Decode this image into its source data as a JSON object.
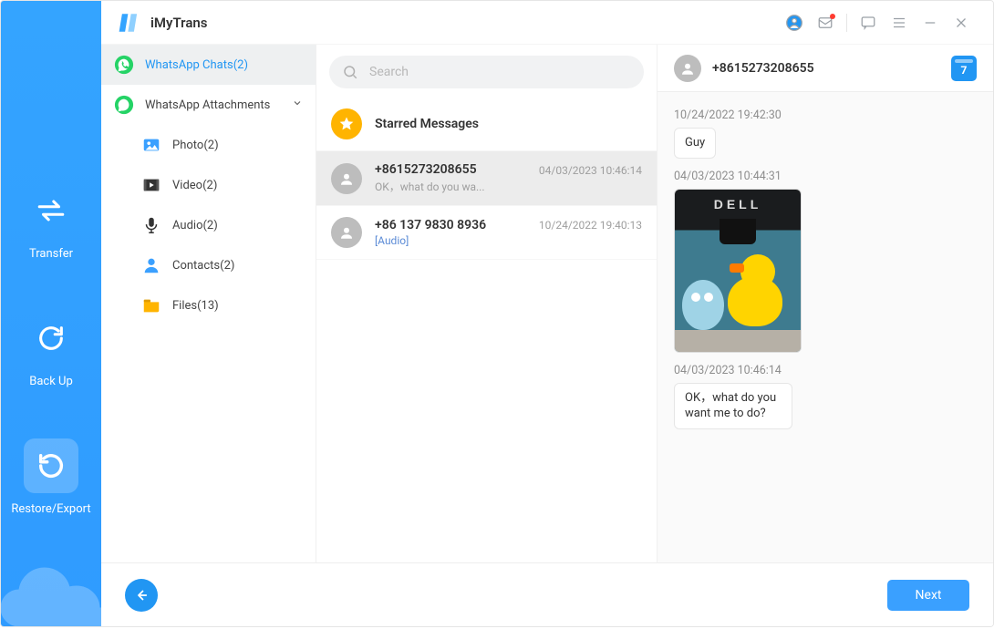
{
  "app": {
    "name": "iMyTrans"
  },
  "titlebar": {
    "calendar_day": "7"
  },
  "rail": {
    "items": [
      {
        "label": "Transfer"
      },
      {
        "label": "Back Up"
      },
      {
        "label": "Restore/Export"
      }
    ]
  },
  "tree": {
    "chats": {
      "label": "WhatsApp Chats(2)"
    },
    "attachments": {
      "label": "WhatsApp Attachments"
    },
    "photo": {
      "label": "Photo(2)"
    },
    "video": {
      "label": "Video(2)"
    },
    "audio": {
      "label": "Audio(2)"
    },
    "contacts": {
      "label": "Contacts(2)"
    },
    "files": {
      "label": "Files(13)"
    }
  },
  "search": {
    "placeholder": "Search"
  },
  "chats": {
    "starred": {
      "title": "Starred Messages"
    },
    "items": [
      {
        "title": "+8615273208655",
        "sub": "OK，what do you wa...",
        "time": "04/03/2023 10:46:14"
      },
      {
        "title": "+86 137 9830 8936",
        "sub": "[Audio]",
        "time": "10/24/2022 19:40:13"
      }
    ]
  },
  "conversation": {
    "contact": "+8615273208655",
    "messages": [
      {
        "ts": "10/24/2022 19:42:30",
        "type": "text",
        "body": "Guy"
      },
      {
        "ts": "04/03/2023 10:44:31",
        "type": "image"
      },
      {
        "ts": "04/03/2023 10:46:14",
        "type": "text",
        "body": "OK，what do you want me to do?"
      }
    ]
  },
  "footer": {
    "next": "Next"
  }
}
